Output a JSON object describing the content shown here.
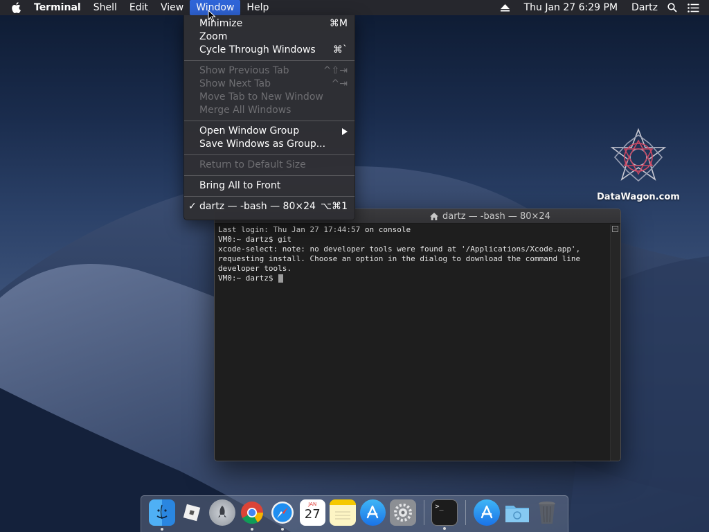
{
  "menubar": {
    "app_name": "Terminal",
    "menus": [
      "Shell",
      "Edit",
      "View",
      "Window",
      "Help"
    ],
    "date_time": "Thu Jan 27  6:29 PM",
    "user": "Dartz",
    "icons": [
      "apple-icon",
      "eject-icon",
      "spotlight-search-icon",
      "notification-center-icon"
    ]
  },
  "window_menu": {
    "items": [
      {
        "label": "Minimize",
        "shortcut": "⌘M"
      },
      {
        "label": "Zoom",
        "shortcut": ""
      },
      {
        "label": "Cycle Through Windows",
        "shortcut": "⌘`"
      },
      {
        "label": "Show Previous Tab",
        "shortcut": "^⇧⇥"
      },
      {
        "label": "Show Next Tab",
        "shortcut": "^⇥"
      },
      {
        "label": "Move Tab to New Window",
        "shortcut": ""
      },
      {
        "label": "Merge All Windows",
        "shortcut": ""
      },
      {
        "label": "Open Window Group",
        "shortcut": ""
      },
      {
        "label": "Save Windows as Group...",
        "shortcut": ""
      },
      {
        "label": "Return to Default Size",
        "shortcut": ""
      },
      {
        "label": "Bring All to Front",
        "shortcut": ""
      },
      {
        "label": "dartz — -bash — 80×24",
        "shortcut": "⌥⌘1",
        "check": "✓"
      }
    ]
  },
  "terminal": {
    "title": "dartz — -bash — 80×24",
    "lines": [
      "Last login: Thu Jan 27 17:44:57 on console",
      "VM0:~ dartz$ git",
      "xcode-select: note: no developer tools were found at '/Applications/Xcode.app',",
      "requesting install. Choose an option in the dialog to download the command line",
      "developer tools.",
      "VM0:~ dartz$ "
    ]
  },
  "desktop": {
    "watermark_label": "DataWagon.com"
  },
  "dock": {
    "items": [
      "finder-icon",
      "roblox-icon",
      "launchpad-icon",
      "chrome-icon",
      "safari-icon",
      "calendar-icon",
      "notes-icon",
      "app-store-icon",
      "system-preferences-icon",
      "terminal-icon",
      "app-store-download-icon",
      "downloads-folder-icon",
      "trash-icon"
    ],
    "calendar_month": "JAN",
    "calendar_day": "27",
    "terminal_prompt": ">_"
  },
  "colors": {
    "menu_highlight": "#2f65d8",
    "terminal_bg": "#1e1e1e",
    "menubar_bg": "#28282c"
  }
}
